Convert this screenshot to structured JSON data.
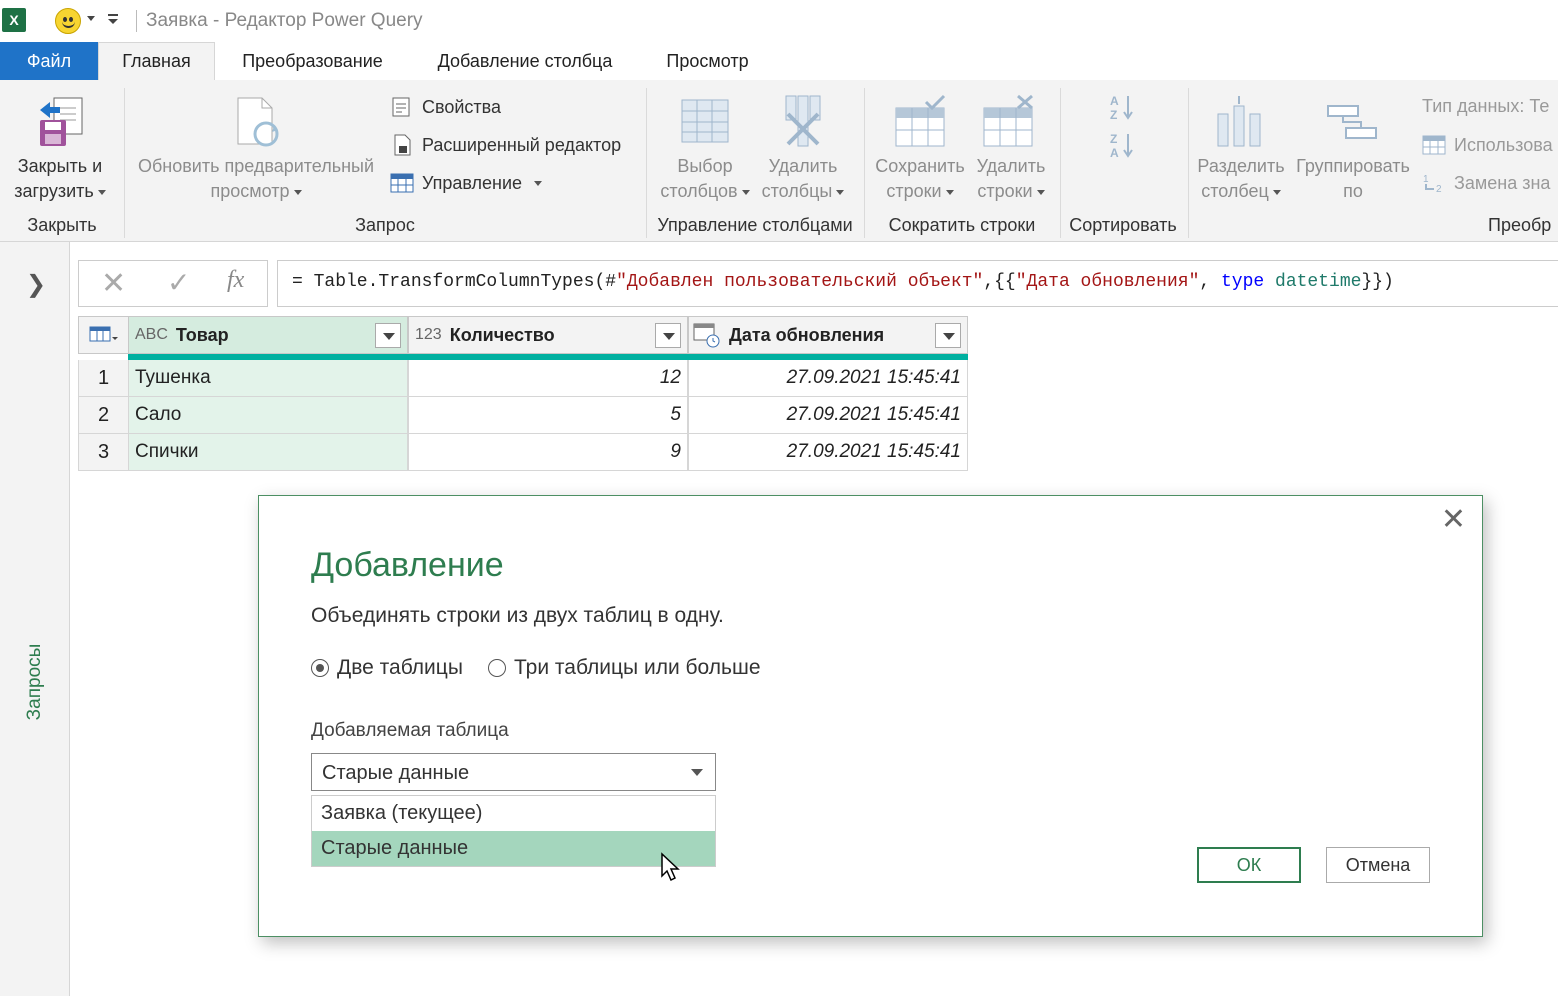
{
  "window": {
    "title": "Заявка - Редактор Power Query",
    "app_icon": "X"
  },
  "tabs": [
    "Файл",
    "Главная",
    "Преобразование",
    "Добавление столбца",
    "Просмотр"
  ],
  "ribbon": {
    "close_group": {
      "label": "Закрыть",
      "button_line1": "Закрыть и",
      "button_line2": "загрузить"
    },
    "query_group": {
      "label": "Запрос",
      "refresh_line1": "Обновить предварительный",
      "refresh_line2": "просмотр",
      "properties": "Свойства",
      "advanced_editor": "Расширенный редактор",
      "manage": "Управление"
    },
    "columns_group": {
      "label": "Управление столбцами",
      "choose_line1": "Выбор",
      "choose_line2": "столбцов",
      "remove_line1": "Удалить",
      "remove_line2": "столбцы"
    },
    "rows_group": {
      "label": "Сократить строки",
      "keep_line1": "Сохранить",
      "keep_line2": "строки",
      "remove_line1": "Удалить",
      "remove_line2": "строки"
    },
    "sort_group": {
      "label": "Сортировать"
    },
    "transform_group": {
      "label": "Преобр",
      "split_line1": "Разделить",
      "split_line2": "столбец",
      "group_line1": "Группировать",
      "group_line2": "по",
      "datatype": "Тип данных: Те",
      "use_first": "Использова",
      "replace": "Замена зна"
    }
  },
  "left_pane": {
    "label": "Запросы"
  },
  "formula": {
    "prefix": "= Table.TransformColumnTypes(#",
    "str1": "\"Добавлен пользовательский объект\"",
    "mid": ",{{",
    "str2": "\"Дата обновления\"",
    "comma": ", ",
    "kw": "type",
    "space": " ",
    "type": "datetime",
    "suffix": "}})"
  },
  "grid": {
    "columns": [
      {
        "name": "Товар",
        "type_icon": "ABC"
      },
      {
        "name": "Количество",
        "type_icon": "123"
      },
      {
        "name": "Дата обновления",
        "type_icon": "datetime-icon"
      }
    ],
    "rows": [
      {
        "n": "1",
        "item": "Тушенка",
        "qty": "12",
        "date": "27.09.2021 15:45:41"
      },
      {
        "n": "2",
        "item": "Сало",
        "qty": "5",
        "date": "27.09.2021 15:45:41"
      },
      {
        "n": "3",
        "item": "Спички",
        "qty": "9",
        "date": "27.09.2021 15:45:41"
      }
    ]
  },
  "dialog": {
    "title": "Добавление",
    "description": "Объединять строки из двух таблиц в одну.",
    "radio_two": "Две таблицы",
    "radio_three": "Три таблицы или больше",
    "radio_selected": "two",
    "field_label": "Добавляемая таблица",
    "selected_value": "Старые данные",
    "options": [
      "Заявка (текущее)",
      "Старые данные"
    ],
    "ok": "ОК",
    "cancel": "Отмена"
  }
}
